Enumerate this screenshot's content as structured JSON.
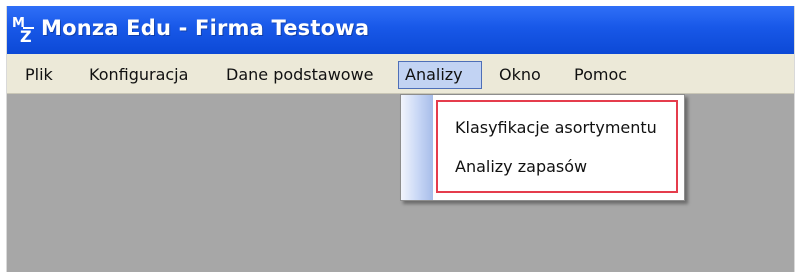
{
  "window": {
    "title": "Monza Edu - Firma Testowa",
    "logo_text": "MZ"
  },
  "menubar": {
    "items": [
      {
        "label": "Plik"
      },
      {
        "label": "Konfiguracja"
      },
      {
        "label": "Dane podstawowe"
      },
      {
        "label": "Analizy",
        "active": true
      },
      {
        "label": "Okno"
      },
      {
        "label": "Pomoc"
      }
    ]
  },
  "dropdown": {
    "items": [
      {
        "label": "Klasyfikacje asortymentu"
      },
      {
        "label": "Analizy zapasów"
      }
    ],
    "highlight_color": "#e53c4c"
  },
  "colors": {
    "titlebar": "#1858e8",
    "menubar": "#ece9d8",
    "workspace": "#a7a7a7",
    "active_menu": "#c2d3f3"
  }
}
